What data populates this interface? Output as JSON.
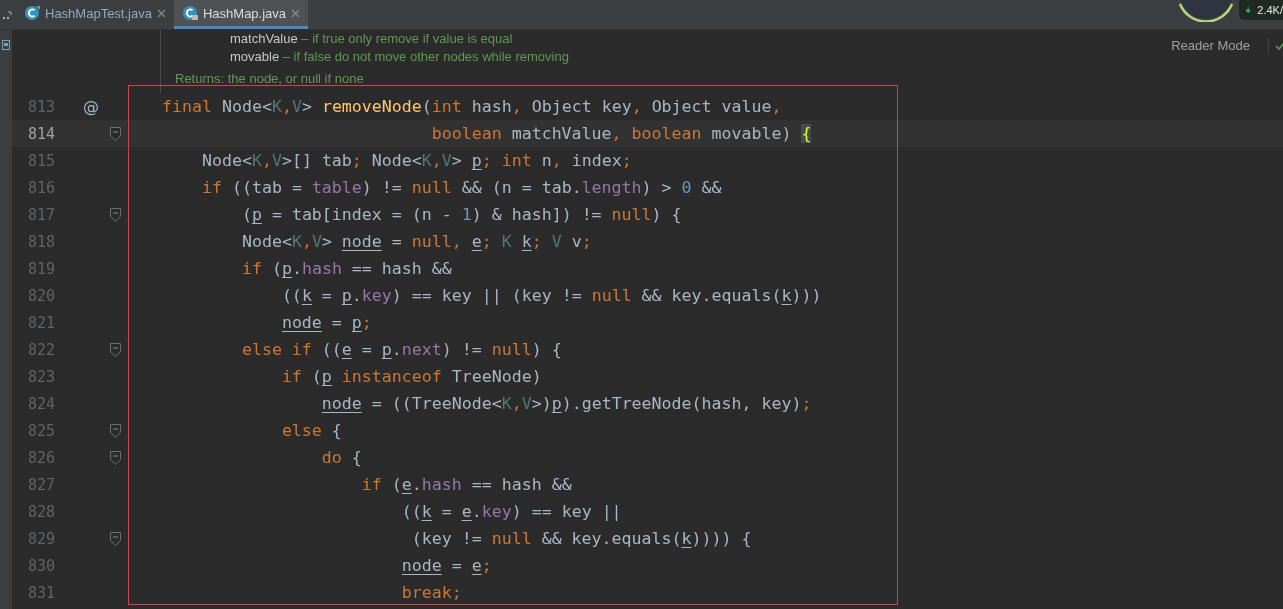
{
  "tabs": [
    {
      "label": "HashMapTest.java",
      "selected": false,
      "kind": "runnable"
    },
    {
      "label": "HashMap.java",
      "selected": true,
      "kind": "locked"
    }
  ],
  "network_widget": {
    "speed": "2.4K/"
  },
  "reader_mode": "Reader Mode",
  "doc": {
    "params": [
      {
        "name": "matchValue",
        "description": "– if true only remove if value is equal"
      },
      {
        "name": "movable",
        "description": "– if false do not move other nodes while removing"
      }
    ],
    "returns": "Returns: the node, or null if none"
  },
  "lines": [
    {
      "number": "813",
      "gutter_mark": "@",
      "fold": false,
      "current": false,
      "tokens": [
        {
          "kind": "kw",
          "text": "final "
        },
        {
          "kind": "plain",
          "text": "Node<"
        },
        {
          "kind": "tparam",
          "text": "K"
        },
        {
          "kind": "punct",
          "text": ","
        },
        {
          "kind": "tparam",
          "text": "V"
        },
        {
          "kind": "plain",
          "text": "> "
        },
        {
          "kind": "method",
          "text": "removeNode"
        },
        {
          "kind": "plain",
          "text": "("
        },
        {
          "kind": "kw",
          "text": "int "
        },
        {
          "kind": "plain",
          "text": "hash"
        },
        {
          "kind": "punct",
          "text": ","
        },
        {
          "kind": "plain",
          "text": " Object key"
        },
        {
          "kind": "punct",
          "text": ","
        },
        {
          "kind": "plain",
          "text": " Object value"
        },
        {
          "kind": "punct",
          "text": ","
        }
      ]
    },
    {
      "number": "814",
      "fold": true,
      "current": true,
      "tokens": [
        {
          "kind": "kw",
          "text": "                           boolean "
        },
        {
          "kind": "plain",
          "text": "matchValue"
        },
        {
          "kind": "punct",
          "text": ","
        },
        {
          "kind": "kw",
          "text": " boolean "
        },
        {
          "kind": "plain",
          "text": "movable) "
        },
        {
          "kind": "match",
          "text": "{"
        }
      ]
    },
    {
      "number": "815",
      "fold": false,
      "current": false,
      "tokens": [
        {
          "kind": "plain",
          "text": "    Node<"
        },
        {
          "kind": "tparam",
          "text": "K"
        },
        {
          "kind": "punct",
          "text": ","
        },
        {
          "kind": "tparam",
          "text": "V"
        },
        {
          "kind": "plain",
          "text": ">[] tab"
        },
        {
          "kind": "punct",
          "text": ";"
        },
        {
          "kind": "plain",
          "text": " Node<"
        },
        {
          "kind": "tparam",
          "text": "K"
        },
        {
          "kind": "punct",
          "text": ","
        },
        {
          "kind": "tparam",
          "text": "V"
        },
        {
          "kind": "plain",
          "text": "> "
        },
        {
          "kind": "var",
          "text": "p"
        },
        {
          "kind": "punct",
          "text": ";"
        },
        {
          "kind": "kw",
          "text": " int "
        },
        {
          "kind": "plain",
          "text": "n"
        },
        {
          "kind": "punct",
          "text": ","
        },
        {
          "kind": "plain",
          "text": " index"
        },
        {
          "kind": "punct",
          "text": ";"
        }
      ]
    },
    {
      "number": "816",
      "fold": false,
      "current": false,
      "tokens": [
        {
          "kind": "kw",
          "text": "    if "
        },
        {
          "kind": "plain",
          "text": "((tab = "
        },
        {
          "kind": "field",
          "text": "table"
        },
        {
          "kind": "plain",
          "text": ") != "
        },
        {
          "kind": "kw",
          "text": "null "
        },
        {
          "kind": "plain",
          "text": "&& (n = tab."
        },
        {
          "kind": "field",
          "text": "length"
        },
        {
          "kind": "plain",
          "text": ") > "
        },
        {
          "kind": "num",
          "text": "0 "
        },
        {
          "kind": "plain",
          "text": "&&"
        }
      ]
    },
    {
      "number": "817",
      "fold": true,
      "current": false,
      "tokens": [
        {
          "kind": "plain",
          "text": "        ("
        },
        {
          "kind": "var",
          "text": "p"
        },
        {
          "kind": "plain",
          "text": " = tab[index = (n - "
        },
        {
          "kind": "num",
          "text": "1"
        },
        {
          "kind": "plain",
          "text": ") & hash]) != "
        },
        {
          "kind": "kw",
          "text": "null"
        },
        {
          "kind": "plain",
          "text": ") {"
        }
      ]
    },
    {
      "number": "818",
      "fold": false,
      "current": false,
      "tokens": [
        {
          "kind": "plain",
          "text": "        Node<"
        },
        {
          "kind": "tparam",
          "text": "K"
        },
        {
          "kind": "punct",
          "text": ","
        },
        {
          "kind": "tparam",
          "text": "V"
        },
        {
          "kind": "plain",
          "text": "> "
        },
        {
          "kind": "var",
          "text": "node"
        },
        {
          "kind": "plain",
          "text": " = "
        },
        {
          "kind": "kw",
          "text": "null"
        },
        {
          "kind": "punct",
          "text": ","
        },
        {
          "kind": "var",
          "text": " e"
        },
        {
          "kind": "punct",
          "text": ";"
        },
        {
          "kind": "tparam",
          "text": " K "
        },
        {
          "kind": "var",
          "text": "k"
        },
        {
          "kind": "punct",
          "text": ";"
        },
        {
          "kind": "tparam",
          "text": " V "
        },
        {
          "kind": "plain",
          "text": "v"
        },
        {
          "kind": "punct",
          "text": ";"
        }
      ]
    },
    {
      "number": "819",
      "fold": false,
      "current": false,
      "tokens": [
        {
          "kind": "kw",
          "text": "        if "
        },
        {
          "kind": "plain",
          "text": "("
        },
        {
          "kind": "var",
          "text": "p"
        },
        {
          "kind": "plain",
          "text": "."
        },
        {
          "kind": "field",
          "text": "hash"
        },
        {
          "kind": "plain",
          "text": " == hash &&"
        }
      ]
    },
    {
      "number": "820",
      "fold": false,
      "current": false,
      "tokens": [
        {
          "kind": "plain",
          "text": "            (("
        },
        {
          "kind": "var",
          "text": "k"
        },
        {
          "kind": "plain",
          "text": " = "
        },
        {
          "kind": "var",
          "text": "p"
        },
        {
          "kind": "plain",
          "text": "."
        },
        {
          "kind": "field",
          "text": "key"
        },
        {
          "kind": "plain",
          "text": ") == key || (key != "
        },
        {
          "kind": "kw",
          "text": "null "
        },
        {
          "kind": "plain",
          "text": "&& key.equals("
        },
        {
          "kind": "var",
          "text": "k"
        },
        {
          "kind": "plain",
          "text": ")))"
        }
      ]
    },
    {
      "number": "821",
      "fold": false,
      "current": false,
      "tokens": [
        {
          "kind": "var",
          "text": "            node"
        },
        {
          "kind": "plain",
          "text": " = "
        },
        {
          "kind": "var",
          "text": "p"
        },
        {
          "kind": "punct",
          "text": ";"
        }
      ]
    },
    {
      "number": "822",
      "fold": true,
      "current": false,
      "tokens": [
        {
          "kind": "kw",
          "text": "        else if "
        },
        {
          "kind": "plain",
          "text": "(("
        },
        {
          "kind": "var",
          "text": "e"
        },
        {
          "kind": "plain",
          "text": " = "
        },
        {
          "kind": "var",
          "text": "p"
        },
        {
          "kind": "plain",
          "text": "."
        },
        {
          "kind": "field",
          "text": "next"
        },
        {
          "kind": "plain",
          "text": ") != "
        },
        {
          "kind": "kw",
          "text": "null"
        },
        {
          "kind": "plain",
          "text": ") {"
        }
      ]
    },
    {
      "number": "823",
      "fold": false,
      "current": false,
      "tokens": [
        {
          "kind": "kw",
          "text": "            if "
        },
        {
          "kind": "plain",
          "text": "("
        },
        {
          "kind": "var",
          "text": "p"
        },
        {
          "kind": "kw",
          "text": " instanceof "
        },
        {
          "kind": "plain",
          "text": "TreeNode)"
        }
      ]
    },
    {
      "number": "824",
      "fold": false,
      "current": false,
      "tokens": [
        {
          "kind": "var",
          "text": "                node"
        },
        {
          "kind": "plain",
          "text": " = ((TreeNode<"
        },
        {
          "kind": "tparam",
          "text": "K"
        },
        {
          "kind": "punct",
          "text": ","
        },
        {
          "kind": "tparam",
          "text": "V"
        },
        {
          "kind": "plain",
          "text": ">)"
        },
        {
          "kind": "var",
          "text": "p"
        },
        {
          "kind": "plain",
          "text": ").getTreeNode(hash, key)"
        },
        {
          "kind": "punct",
          "text": ";"
        }
      ]
    },
    {
      "number": "825",
      "fold": true,
      "current": false,
      "tokens": [
        {
          "kind": "kw",
          "text": "            else "
        },
        {
          "kind": "plain",
          "text": "{"
        }
      ]
    },
    {
      "number": "826",
      "fold": true,
      "current": false,
      "tokens": [
        {
          "kind": "kw",
          "text": "                do "
        },
        {
          "kind": "plain",
          "text": "{"
        }
      ]
    },
    {
      "number": "827",
      "fold": false,
      "current": false,
      "tokens": [
        {
          "kind": "kw",
          "text": "                    if "
        },
        {
          "kind": "plain",
          "text": "("
        },
        {
          "kind": "var",
          "text": "e"
        },
        {
          "kind": "plain",
          "text": "."
        },
        {
          "kind": "field",
          "text": "hash"
        },
        {
          "kind": "plain",
          "text": " == hash &&"
        }
      ]
    },
    {
      "number": "828",
      "fold": false,
      "current": false,
      "tokens": [
        {
          "kind": "plain",
          "text": "                        (("
        },
        {
          "kind": "var",
          "text": "k"
        },
        {
          "kind": "plain",
          "text": " = "
        },
        {
          "kind": "var",
          "text": "e"
        },
        {
          "kind": "plain",
          "text": "."
        },
        {
          "kind": "field",
          "text": "key"
        },
        {
          "kind": "plain",
          "text": ") == key ||"
        }
      ]
    },
    {
      "number": "829",
      "fold": true,
      "current": false,
      "tokens": [
        {
          "kind": "plain",
          "text": "                         (key != "
        },
        {
          "kind": "kw",
          "text": "null "
        },
        {
          "kind": "plain",
          "text": "&& key.equals("
        },
        {
          "kind": "var",
          "text": "k"
        },
        {
          "kind": "plain",
          "text": ")))) {"
        }
      ]
    },
    {
      "number": "830",
      "fold": false,
      "current": false,
      "tokens": [
        {
          "kind": "var",
          "text": "                        node"
        },
        {
          "kind": "plain",
          "text": " = "
        },
        {
          "kind": "var",
          "text": "e"
        },
        {
          "kind": "punct",
          "text": ";"
        }
      ]
    },
    {
      "number": "831",
      "fold": false,
      "current": false,
      "tokens": [
        {
          "kind": "kw",
          "text": "                        break"
        },
        {
          "kind": "punct",
          "text": ";"
        }
      ]
    }
  ]
}
